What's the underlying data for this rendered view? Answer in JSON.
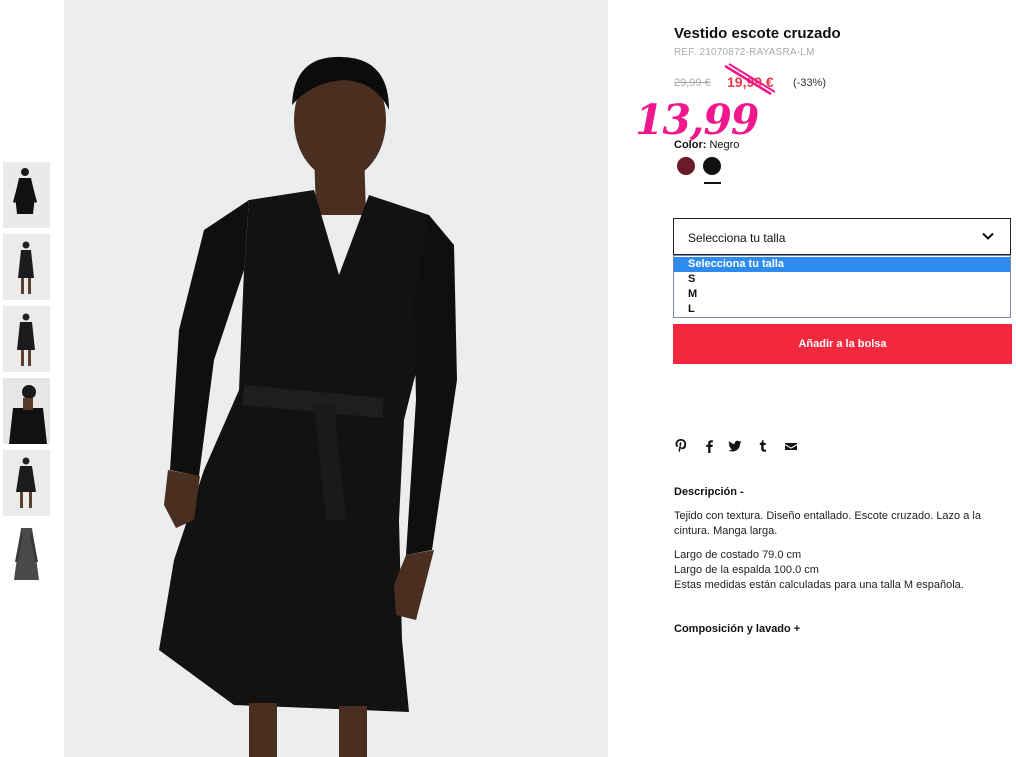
{
  "product": {
    "title": "Vestido escote cruzado",
    "ref": "REF. 21070872-RAYASRA-LM",
    "old_price": "29,99 €",
    "sale_price": "19,99 €",
    "discount": "(-33%)",
    "handwritten_price": "13,99"
  },
  "color": {
    "label": "Color:",
    "value": "Negro",
    "swatches": [
      {
        "name": "burgundy",
        "hex": "#6b1a2b"
      },
      {
        "name": "black",
        "hex": "#111111",
        "selected": true
      }
    ]
  },
  "size": {
    "select_label": "Selecciona tu talla",
    "options": [
      "Selecciona tu talla",
      "S",
      "M",
      "L"
    ],
    "selected_index": 0
  },
  "cart": {
    "add_label": "Añadir a la bolsa"
  },
  "share_icons": [
    "pinterest-icon",
    "facebook-icon",
    "twitter-icon",
    "tumblr-icon",
    "email-icon"
  ],
  "description": {
    "heading": "Descripción -",
    "text1": "Tejido con textura. Diseño entallado. Escote cruzado. Lazo a la cintura. Manga larga.",
    "line1": "Largo de costado 79.0 cm",
    "line2": "Largo de la espalda 100.0 cm",
    "line3": "Estas medidas están calculadas para una talla M española."
  },
  "composition": {
    "heading": "Composición y lavado +"
  },
  "colors": {
    "accent_red": "#f2293e",
    "sale_red": "#e8364a",
    "handwritten_pink": "#f0188c",
    "select_blue": "#2e8cf0"
  }
}
